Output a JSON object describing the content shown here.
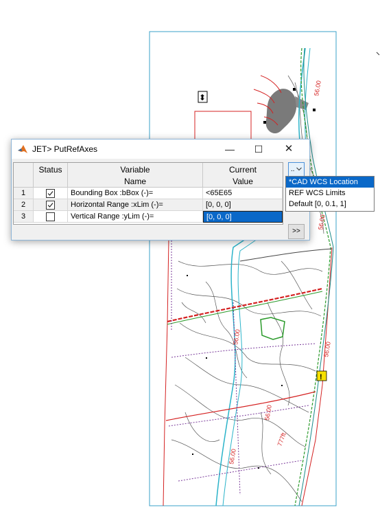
{
  "dialog": {
    "title": "JET> PutRefAxes",
    "min_symbol": "—",
    "max_symbol": "☐",
    "close_symbol": "✕",
    "icon": "matlab-logo-icon"
  },
  "table": {
    "headers": {
      "status": "Status",
      "variable_line1": "Variable",
      "variable_line2": "Name",
      "current_line1": "Current",
      "current_line2": "Value"
    },
    "rows": [
      {
        "num": "1",
        "checked": true,
        "name": "Bounding Box :bBox (-)=",
        "value": "<65E65"
      },
      {
        "num": "2",
        "checked": true,
        "name": "Horizontal Range :xLim (-)=",
        "value": "[0, 0, 0]"
      },
      {
        "num": "3",
        "checked": false,
        "name": "Vertical Range :yLim (-)=",
        "value": "[0, 0, 0]"
      }
    ]
  },
  "buttons": {
    "dropdown_label": "..",
    "more_label": ">>"
  },
  "menu": {
    "items": [
      "*CAD WCS Location",
      "REF WCS Limits",
      "Default [0, 0.1, 1]"
    ],
    "selected": "*CAD WCS Location"
  },
  "drawing": {
    "grip_symbol": "⬍",
    "warning_symbol": "!",
    "red_labels": [
      "56.00",
      "56.00",
      "56.00",
      "56.00",
      "56.00",
      "56.00",
      "777ft."
    ]
  },
  "colors": {
    "selection": "#0a68c8",
    "cad_red": "#d42020",
    "cad_cyan": "#2ab3c9",
    "cad_green": "#2a9a2a",
    "sheet_border": "#3aa0c8"
  }
}
